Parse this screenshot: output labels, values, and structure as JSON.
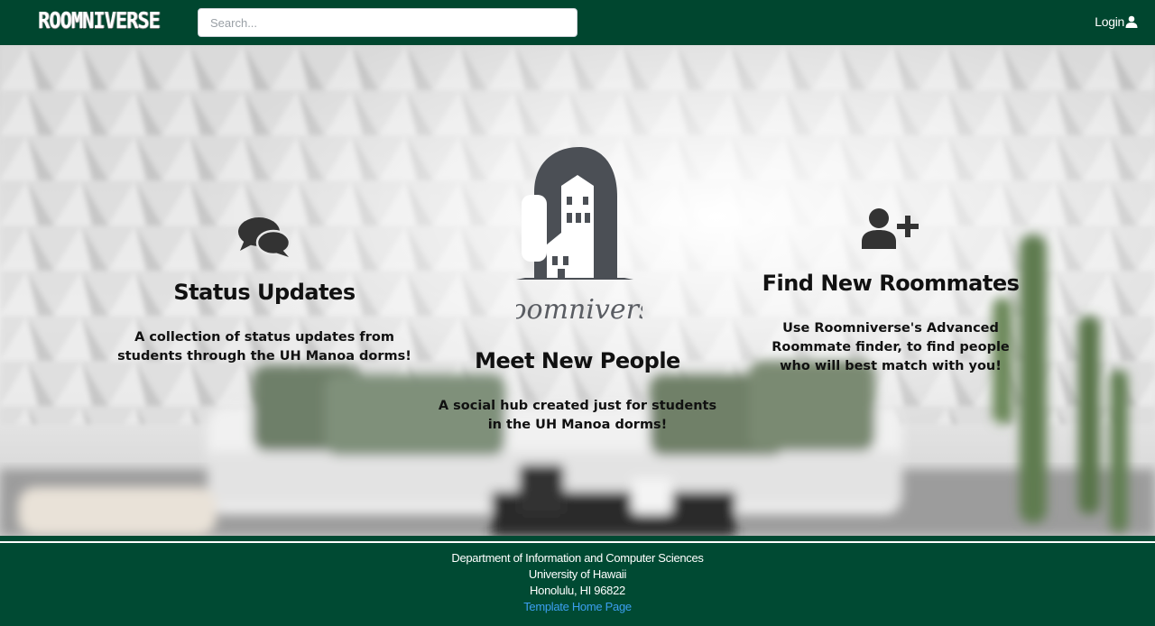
{
  "navbar": {
    "brand": "ROOMNIVERSE",
    "search_placeholder": "Search...",
    "login_label": "Login",
    "login_icon": "user-icon"
  },
  "hero": {
    "left": {
      "icon": "comments-icon",
      "title": "Status Updates",
      "text": "A collection of status updates from students through the UH Manoa dorms!"
    },
    "center": {
      "logo_text": "Roomniverse",
      "title": "Meet New People",
      "text": "A social hub created just for students in the UH Manoa dorms!"
    },
    "right": {
      "icon": "user-plus-icon",
      "title": "Find New Roommates",
      "text": "Use Roomniverse's Advanced Roommate finder, to find people who will best match with you!"
    }
  },
  "footer": {
    "line1": "Department of Information and Computer Sciences",
    "line2": "University of Hawaii",
    "line3": "Honolulu, HI 96822",
    "link": "Template Home Page"
  },
  "colors": {
    "navbar_bg": "#00462f",
    "footer_bg": "#004a33",
    "link": "#3b9ff0",
    "icon_dark": "#3a3a3a"
  }
}
